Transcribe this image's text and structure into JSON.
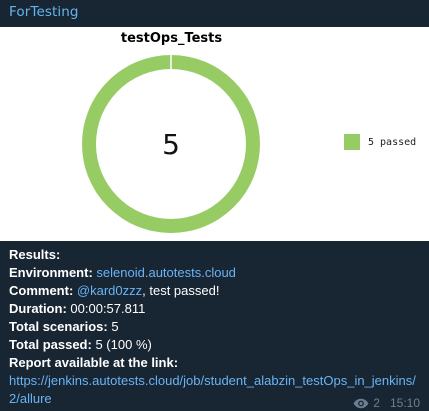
{
  "message": {
    "sender": "ForTesting",
    "views": "2",
    "time": "15:10"
  },
  "chart_data": {
    "type": "pie",
    "title": "testOps_Tests",
    "center_label": "5",
    "categories": [
      "5 passed"
    ],
    "values": [
      5
    ],
    "colors": [
      "#97cc64"
    ],
    "legend_position": "right"
  },
  "results": {
    "heading": "Results:",
    "environment_label": "Environment:",
    "environment_value": "selenoid.autotests.cloud",
    "comment_label": "Comment:",
    "comment_mention": "@kard0zzz",
    "comment_text": ", test passed!",
    "duration_label": "Duration:",
    "duration_value": "00:00:57.811",
    "total_scenarios_label": "Total scenarios:",
    "total_scenarios_value": "5",
    "total_passed_label": "Total passed:",
    "total_passed_value": "5 (100 %)",
    "report_label": "Report available at the link:",
    "report_link": "https://jenkins.autotests.cloud/job/student_alabzin_testOps_in_jenkins/2/allure"
  }
}
